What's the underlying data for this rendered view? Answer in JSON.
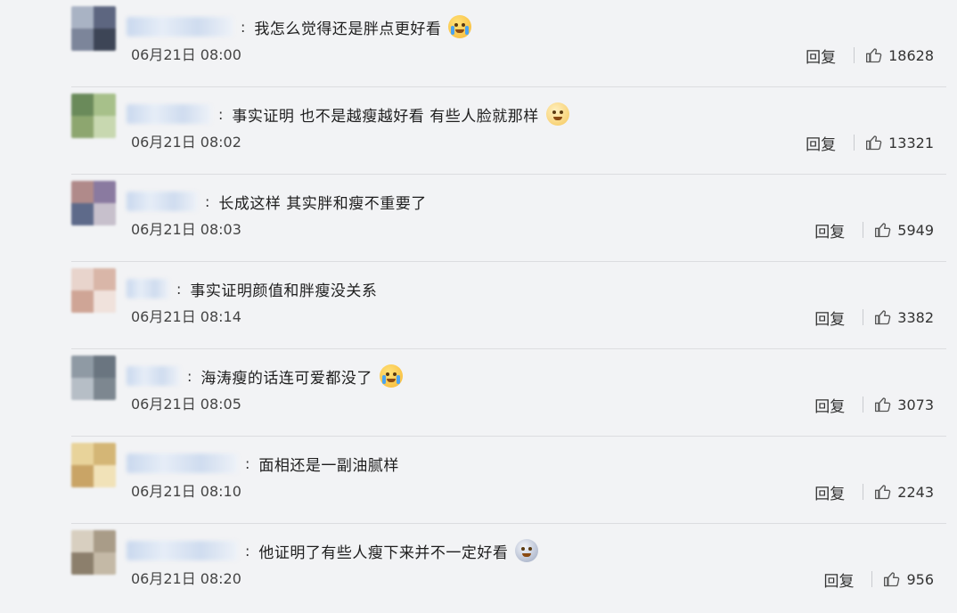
{
  "comments": [
    {
      "username": "████████",
      "username_width": 120,
      "text": "我怎么觉得还是胖点更好看",
      "emoji": "emoji-cry-laugh",
      "time": "06月21日 08:00",
      "reply_label": "回复",
      "likes": "18628",
      "avatar_colors": [
        "#a9b3c4",
        "#5d6680",
        "#7c859a",
        "#3d4556"
      ]
    },
    {
      "username": "██████",
      "username_width": 95,
      "text": "事实证明 也不是越瘦越好看 有些人脸就那样",
      "emoji": "emoji-dog",
      "time": "06月21日 08:02",
      "reply_label": "回复",
      "likes": "13321",
      "avatar_colors": [
        "#6a8a5a",
        "#a7c08a",
        "#8da66f",
        "#c8d8b0"
      ]
    },
    {
      "username": "██████",
      "username_width": 80,
      "text": "长成这样 其实胖和瘦不重要了",
      "emoji": "",
      "time": "06月21日 08:03",
      "reply_label": "回复",
      "likes": "5949",
      "avatar_colors": [
        "#b08a8a",
        "#8a7aa0",
        "#5e6a8a",
        "#c7c0cc"
      ]
    },
    {
      "username": "████",
      "username_width": 48,
      "text": "事实证明颜值和胖瘦没关系",
      "emoji": "",
      "time": "06月21日 08:14",
      "reply_label": "回复",
      "likes": "3382",
      "avatar_colors": [
        "#e8d4cc",
        "#d9b6a8",
        "#cfa596",
        "#f0e2dc"
      ]
    },
    {
      "username": "█████",
      "username_width": 60,
      "text": "海涛瘦的话连可爱都没了",
      "emoji": "emoji-sob",
      "time": "06月21日 08:05",
      "reply_label": "回复",
      "likes": "3073",
      "avatar_colors": [
        "#8f9aa4",
        "#6a7580",
        "#b6bec6",
        "#7d8790"
      ]
    },
    {
      "username": "█████████",
      "username_width": 125,
      "text": "面相还是一副油腻样",
      "emoji": "",
      "time": "06月21日 08:10",
      "reply_label": "回复",
      "likes": "2243",
      "avatar_colors": [
        "#e8d39a",
        "#d4b676",
        "#c9a466",
        "#f1e2b8"
      ]
    },
    {
      "username": "█████████",
      "username_width": 125,
      "text": "他证明了有些人瘦下来并不一定好看",
      "emoji": "emoji-ghost",
      "time": "06月21日 08:20",
      "reply_label": "回复",
      "likes": "956",
      "avatar_colors": [
        "#d8cfc0",
        "#a99c88",
        "#8c7f6c",
        "#c4b9a6"
      ]
    }
  ]
}
